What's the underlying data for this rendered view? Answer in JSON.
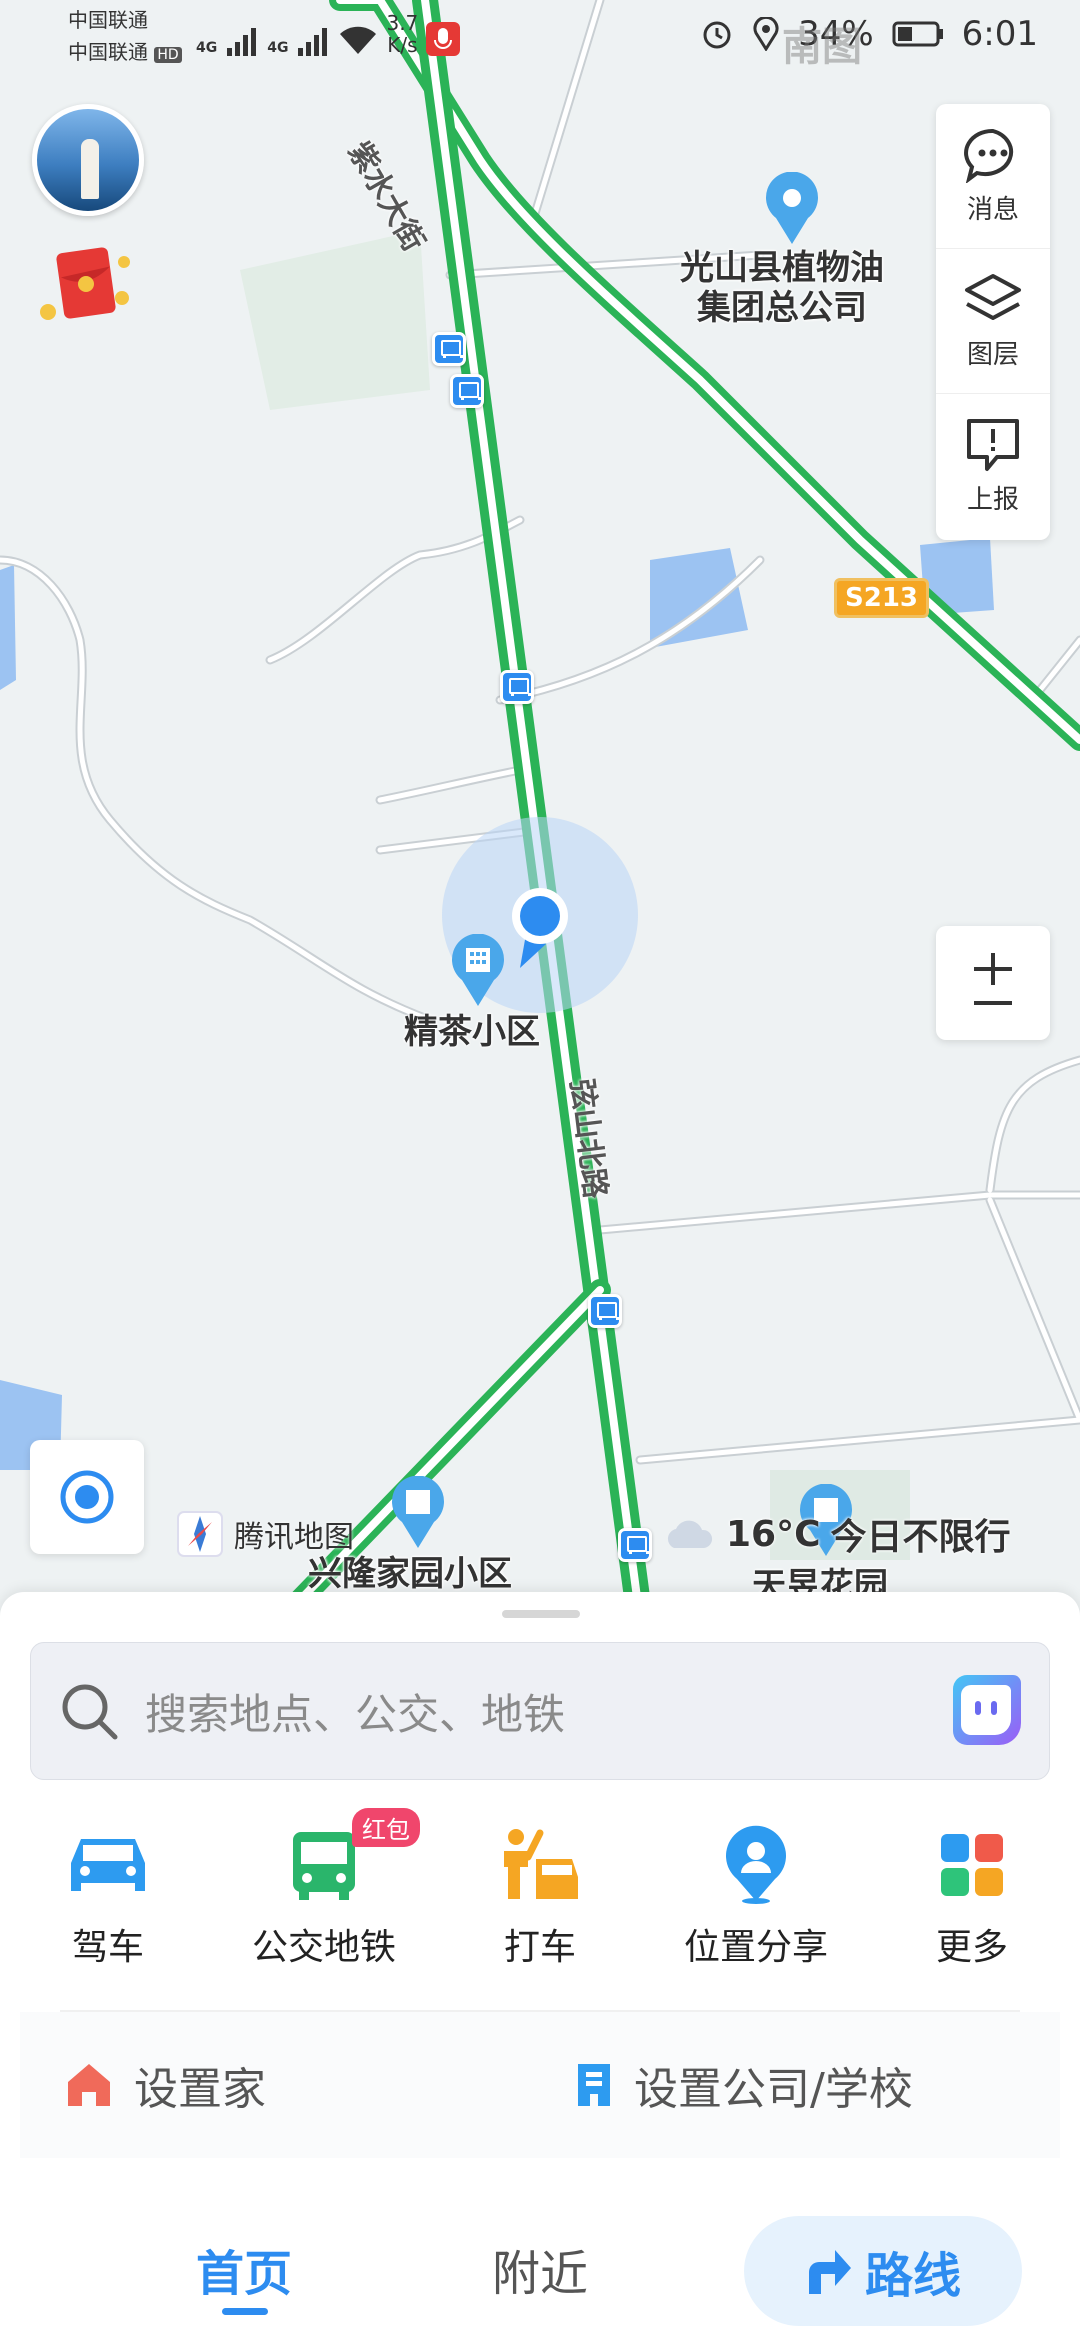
{
  "status_bar": {
    "carrier1": "中国联通",
    "carrier2": "中国联通",
    "carrier2_tag": "HD",
    "net1": "4G",
    "net2": "4G",
    "speed_value": "3.7",
    "speed_unit": "K/s",
    "battery": "34%",
    "time": "6:01",
    "watermark": "南图"
  },
  "map": {
    "labels": {
      "poi_company": "光山县植物油\n集团总公司",
      "poi_jingcha": "精茶小区",
      "poi_xinglong": "兴隆家园小区",
      "poi_tianyu": "天昱花园",
      "road_zihuai": "紫水大街",
      "road_xianshan": "弦山北路",
      "route_s213": "S213"
    },
    "brand": "腾讯地图",
    "weather_temp": "16°C",
    "weather_text": "今日不限行"
  },
  "tools": {
    "messages": "消息",
    "layers": "图层",
    "report": "上报"
  },
  "search": {
    "placeholder": "搜索地点、公交、地铁"
  },
  "shortcuts": [
    {
      "label": "驾车",
      "icon": "car-icon"
    },
    {
      "label": "公交地铁",
      "icon": "bus-icon",
      "badge": "红包"
    },
    {
      "label": "打车",
      "icon": "taxi-icon"
    },
    {
      "label": "位置分享",
      "icon": "location-share-icon"
    },
    {
      "label": "更多",
      "icon": "grid-icon"
    }
  ],
  "places": {
    "home": "设置家",
    "work": "设置公司/学校"
  },
  "tabs": {
    "home": "首页",
    "nearby": "附近",
    "route": "路线"
  },
  "colors": {
    "accent": "#2d8cf0",
    "road_green": "#3cc86a",
    "badge": "#f0466c"
  }
}
